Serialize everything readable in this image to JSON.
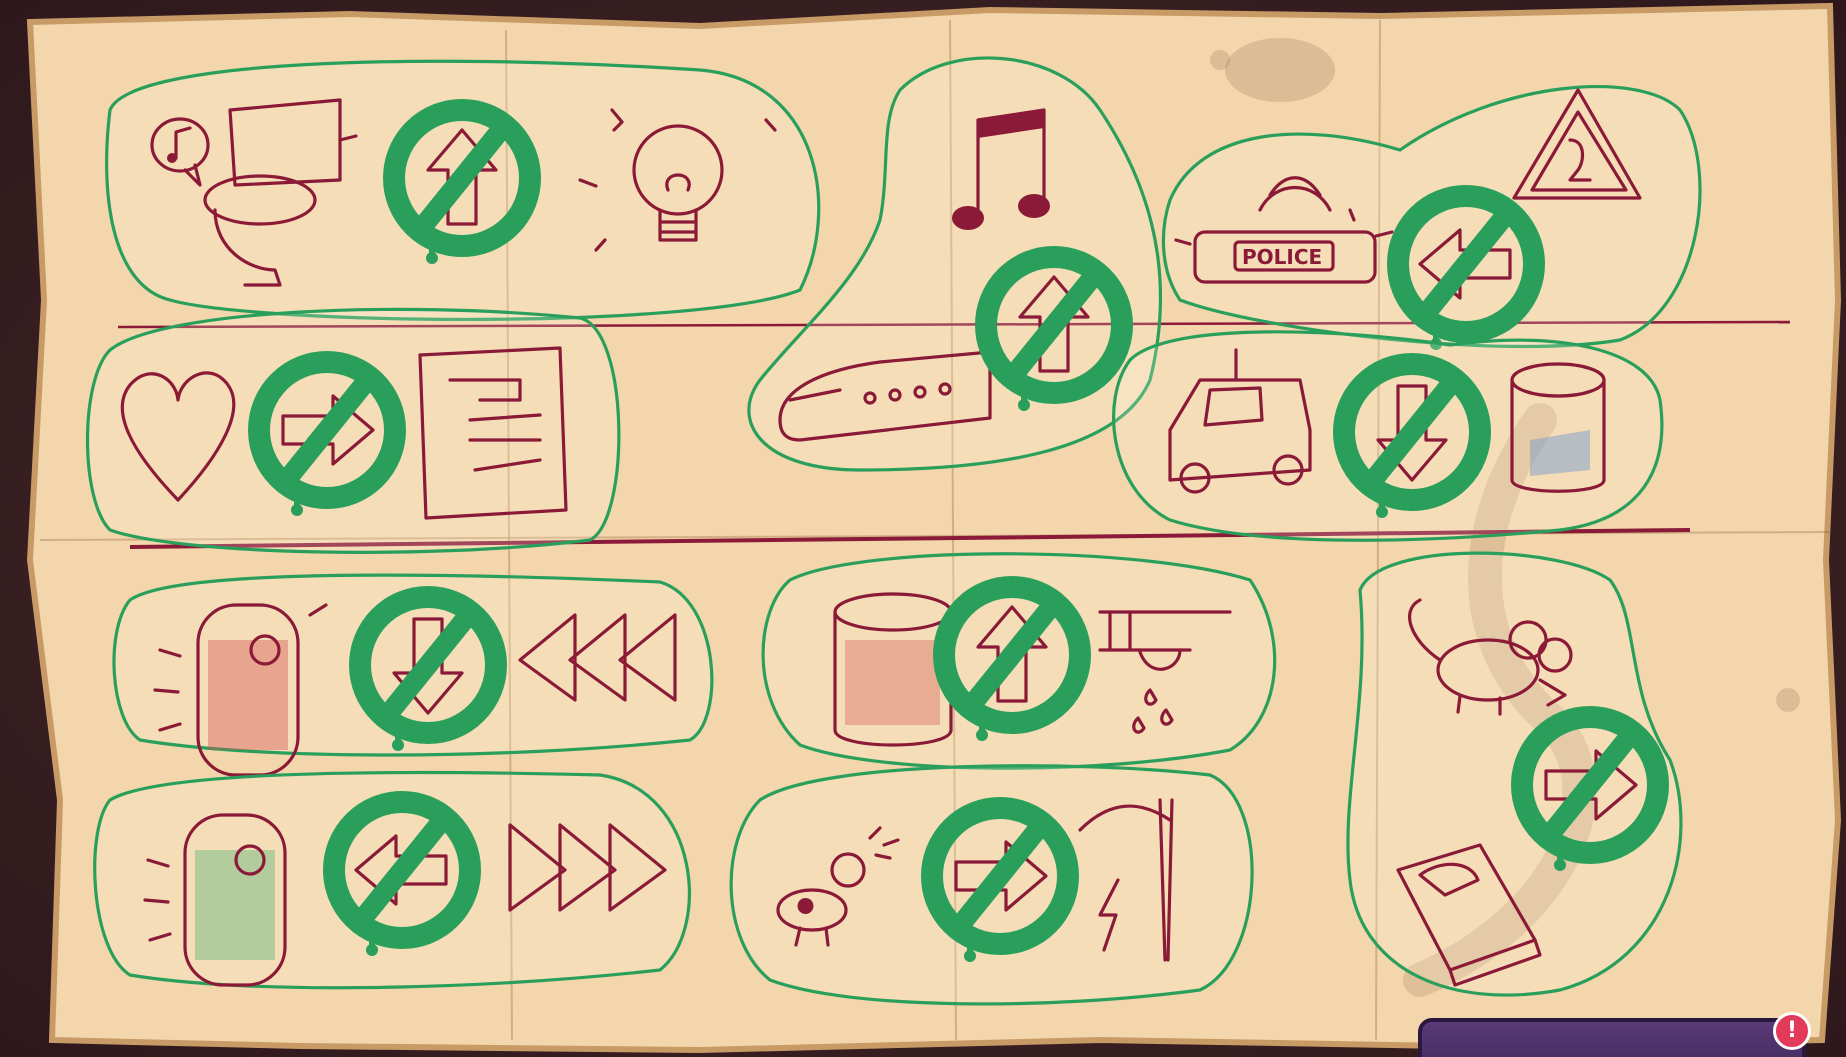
{
  "scene": {
    "name": "rules-map",
    "paper_color": "#f3d6ab",
    "ink_color": "#8a1a38",
    "rule_color": "#2a9f5c"
  },
  "rules": [
    {
      "id": "toilet-up",
      "icons": [
        "toilet-icon",
        "music-note-bubble-icon",
        "no-up-arrow-icon",
        "lightbulb-icon"
      ]
    },
    {
      "id": "heart-right",
      "icons": [
        "heart-icon",
        "no-right-arrow-icon",
        "torn-poster-icon"
      ]
    },
    {
      "id": "music-train-up",
      "icons": [
        "music-note-icon",
        "train-icon",
        "no-up-arrow-icon"
      ]
    },
    {
      "id": "police-left",
      "icons": [
        "police-siren-icon",
        "no-left-arrow-icon",
        "warning-sign-icon"
      ]
    },
    {
      "id": "car-down",
      "icons": [
        "car-icon",
        "no-down-arrow-icon",
        "paint-can-icon"
      ]
    },
    {
      "id": "red-lantern-down",
      "icons": [
        "red-lantern-icon",
        "no-down-arrow-icon",
        "triangles-left-icon"
      ]
    },
    {
      "id": "barrel-up",
      "icons": [
        "barrel-icon",
        "no-up-arrow-icon",
        "leaking-pipe-icon"
      ]
    },
    {
      "id": "mouse-right",
      "icons": [
        "mouse-icon",
        "no-right-arrow-icon",
        "mousetrap-icon"
      ]
    },
    {
      "id": "green-lantern-left",
      "icons": [
        "green-lantern-icon",
        "no-left-arrow-icon",
        "triangles-right-icon"
      ]
    },
    {
      "id": "dog-right",
      "icons": [
        "barking-dog-icon",
        "no-right-arrow-icon",
        "electric-wires-icon"
      ]
    }
  ],
  "police_text": "POLICE",
  "alert": {
    "badge": "!"
  }
}
